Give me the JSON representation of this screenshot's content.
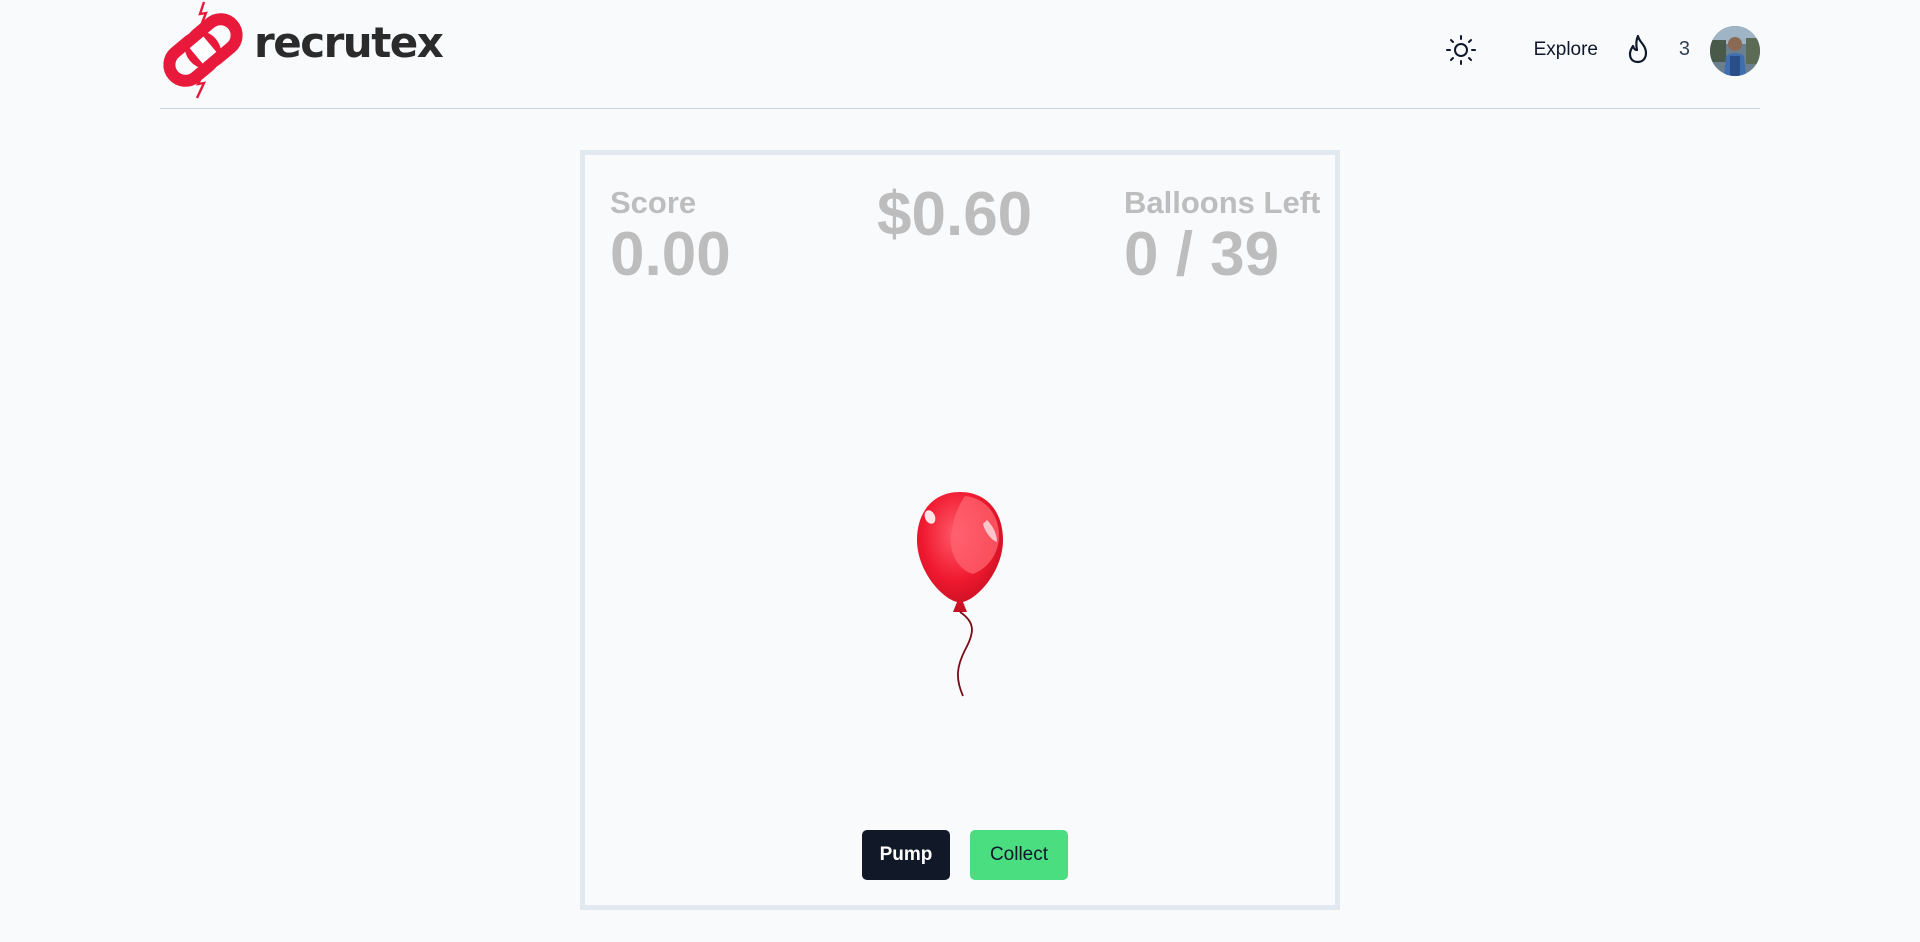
{
  "brand": {
    "name": "recrutex",
    "color": "#e8193a"
  },
  "nav": {
    "theme_icon": "sun-icon",
    "explore_label": "Explore",
    "streak_icon": "flame-icon",
    "streak_count": "3",
    "avatar_icon": "user-avatar"
  },
  "game": {
    "score_label": "Score",
    "score_value": "0.00",
    "money_value": "$0.60",
    "balloons_label": "Balloons Left",
    "balloons_value": "0 / 39",
    "balloon_icon": "red-balloon",
    "balloon_color": "#f0192f",
    "pump_label": "Pump",
    "collect_label": "Collect",
    "pump_color": "#111827",
    "collect_color": "#4ade80"
  }
}
